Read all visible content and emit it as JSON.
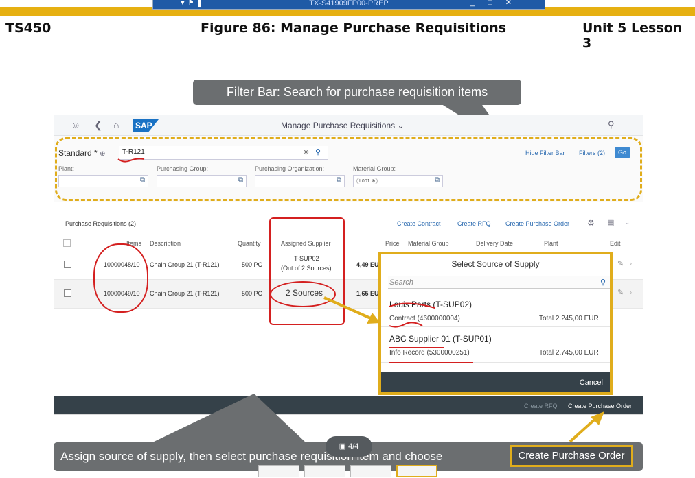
{
  "window": {
    "title": "TX-S41909FP00-PREP"
  },
  "header": {
    "left": "TS450",
    "center": "Figure 86: Manage Purchase Requisitions",
    "right": "Unit 5 Lesson 3"
  },
  "callout_top": "Filter Bar: Search for purchase requisition items",
  "app": {
    "title": "Manage Purchase Requisitions",
    "logo": "SAP",
    "filter": {
      "variant": "Standard *",
      "search_value": "T-R121",
      "hide_filter_bar": "Hide Filter Bar",
      "filters": "Filters (2)",
      "go": "Go",
      "fields": [
        {
          "label": "Plant:",
          "value": ""
        },
        {
          "label": "Purchasing Group:",
          "value": ""
        },
        {
          "label": "Purchasing Organization:",
          "value": ""
        },
        {
          "label": "Material Group:",
          "value": "L001"
        }
      ]
    },
    "table": {
      "title": "Purchase Requisitions (2)",
      "actions": [
        "Create Contract",
        "Create RFQ",
        "Create Purchase Order"
      ],
      "columns": [
        "Items",
        "Description",
        "Quantity",
        "Assigned Supplier",
        "Price",
        "Material Group",
        "Delivery Date",
        "Plant",
        "Edit"
      ],
      "rows": [
        {
          "item": "10000048/10",
          "description": "Chain Group 21 (T-R121)",
          "quantity": "500 PC",
          "supplier": "T-SUP02",
          "supplier_sub": "(Out of 2 Sources)",
          "price": "4,49 EU"
        },
        {
          "item": "10000049/10",
          "description": "Chain Group 21 (T-R121)",
          "quantity": "500 PC",
          "supplier": "2 Sources",
          "price": "1,65 EU"
        }
      ]
    },
    "footer": {
      "create_rfq": "Create RFQ",
      "create_po": "Create Purchase Order"
    }
  },
  "popover": {
    "title": "Select Source of Supply",
    "search_placeholder": "Search",
    "sources": [
      {
        "name": "Louis Parts (T-SUP02)",
        "doc": "Contract (4600000004)",
        "total": "Total 2.245,00 EUR"
      },
      {
        "name": "ABC Supplier 01 (T-SUP01)",
        "doc": "Info Record (5300000251)",
        "total": "Total 2.745,00 EUR"
      }
    ],
    "cancel": "Cancel"
  },
  "caption": {
    "text": "Assign source of supply, then select purchase requisition item and choose",
    "button": "Create Purchase Order"
  },
  "pager": "4/4",
  "colors": {
    "accent_gold": "#e0ad1c",
    "annotation_red": "#d42020",
    "sap_blue": "#2a6ab0"
  }
}
